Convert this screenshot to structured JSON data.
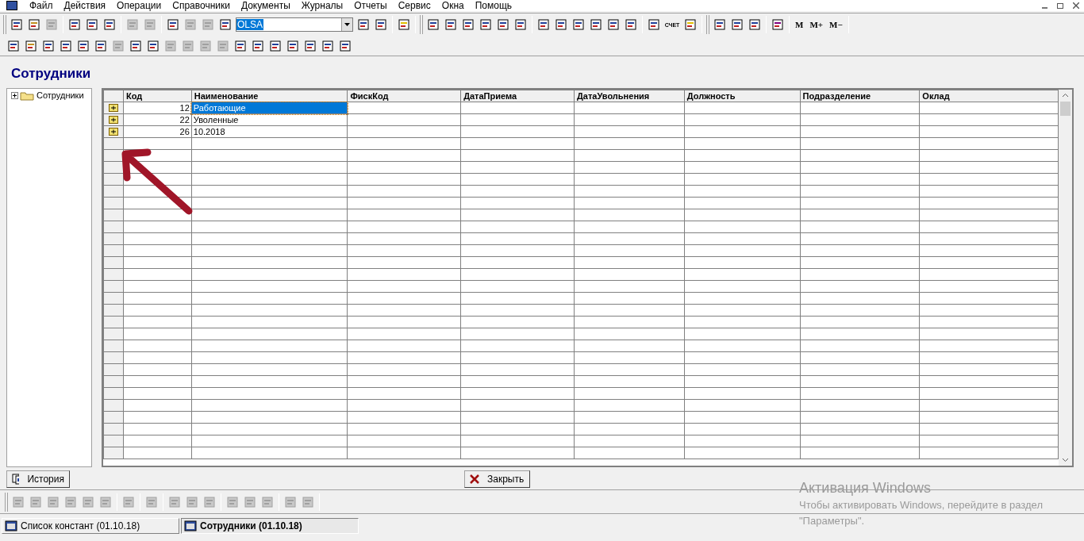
{
  "menu": [
    "Файл",
    "Действия",
    "Операции",
    "Справочники",
    "Документы",
    "Журналы",
    "Отчеты",
    "Сервис",
    "Окна",
    "Помощь"
  ],
  "toolbar": {
    "combo_value": "OLSA",
    "invoice_icon_label": "СЧЕТ",
    "memory_buttons": [
      "M",
      "M+",
      "M−"
    ]
  },
  "form": {
    "title": "Сотрудники",
    "tree": [
      {
        "label": "Сотрудники",
        "expanded": false
      }
    ],
    "table": {
      "columns": [
        "Код",
        "Наименование",
        "ФискКод",
        "ДатаПриема",
        "ДатаУвольнения",
        "Должность",
        "Подразделение",
        "Оклад"
      ],
      "rows": [
        {
          "code": "12",
          "name": "Работающие",
          "selected": true
        },
        {
          "code": "22",
          "name": "Уволенные",
          "selected": false
        },
        {
          "code": "26",
          "name": "10.2018",
          "selected": false
        }
      ]
    },
    "buttons": [
      {
        "kind": "history",
        "label": "История"
      },
      {
        "kind": "close",
        "label": "Закрыть"
      }
    ]
  },
  "taskbar": [
    {
      "label": "Список констант (01.10.18)",
      "selected": false
    },
    {
      "label": "Сотрудники (01.10.18)",
      "selected": true
    }
  ],
  "activation": {
    "title": "Активация Windows",
    "text": "Чтобы активировать Windows, перейдите в раздел \"Параметры\"."
  }
}
